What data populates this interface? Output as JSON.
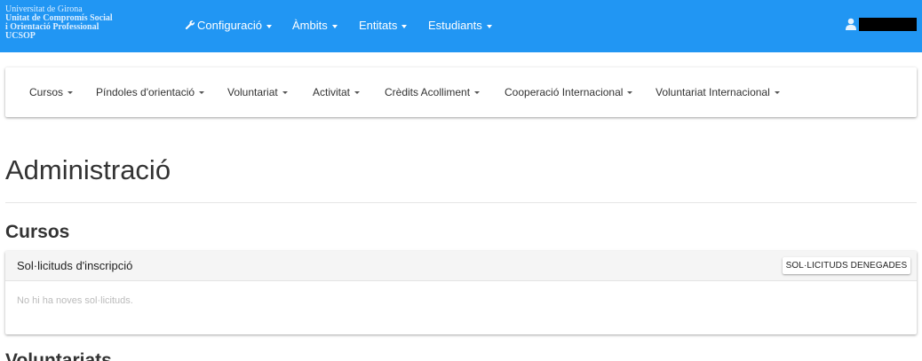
{
  "brand": {
    "line1": "Universitat de Girona",
    "line2": "Unitat de Compromís Social",
    "line3": "i Orientació Professional",
    "line4": "UCSOP"
  },
  "navbar": {
    "items": [
      {
        "label": "Configuració",
        "icon": "wrench-icon"
      },
      {
        "label": "Àmbits"
      },
      {
        "label": "Entitats"
      },
      {
        "label": "Estudiants"
      }
    ],
    "user_icon": "user-icon",
    "color": "#2196f3"
  },
  "subnav": {
    "items": [
      {
        "label": "Cursos"
      },
      {
        "label": "Píndoles d'orientació"
      },
      {
        "label": "Voluntariat"
      },
      {
        "label": "Activitat"
      },
      {
        "label": "Crèdits Acolliment"
      },
      {
        "label": "Cooperació Internacional"
      },
      {
        "label": "Voluntariat Internacional"
      }
    ]
  },
  "page": {
    "title": "Administració"
  },
  "sections": [
    {
      "title": "Cursos",
      "panel": {
        "title": "Sol·licituds d'inscripció",
        "button_label": "SOL·LICITUDS DENEGADES",
        "empty_text": "No hi ha noves sol·licituds."
      }
    },
    {
      "title": "Voluntariats"
    }
  ]
}
